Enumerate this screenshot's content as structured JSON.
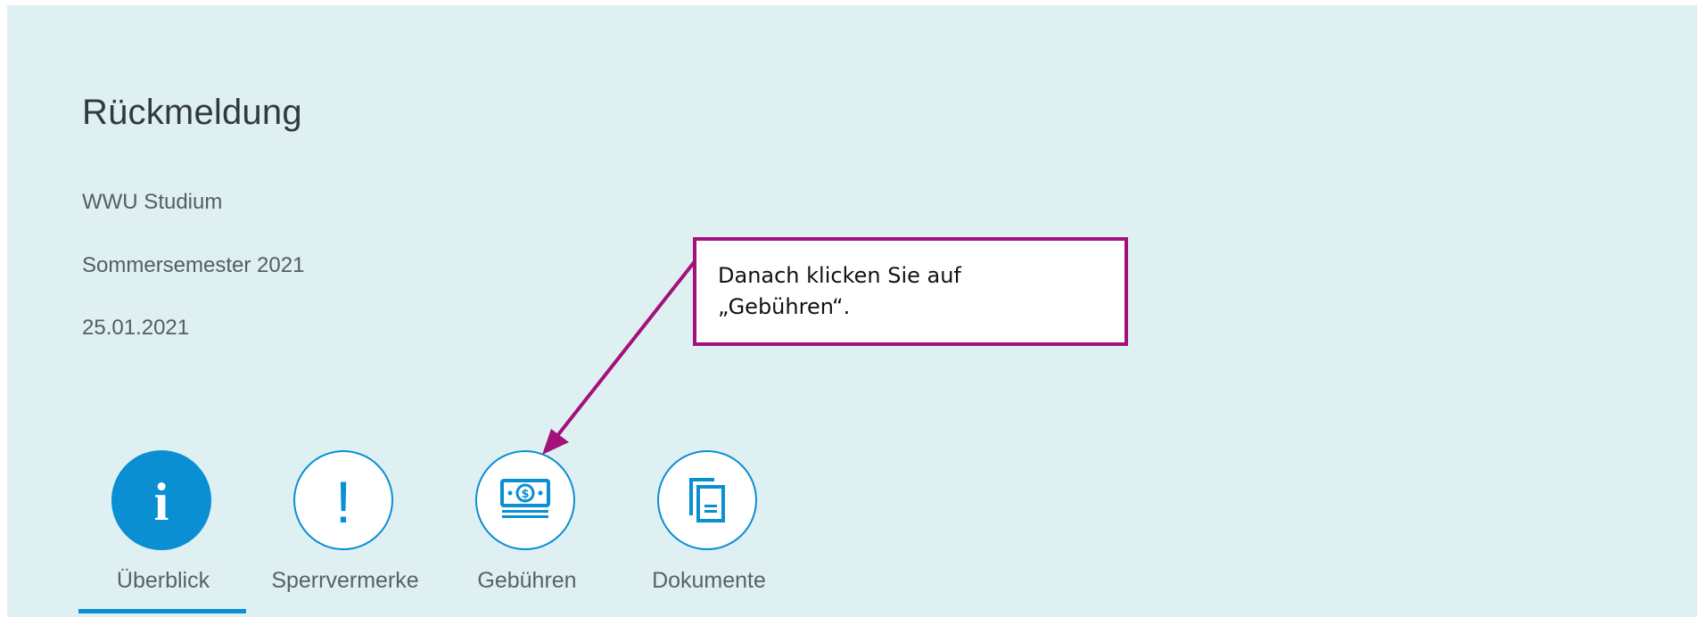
{
  "header": {
    "title": "Rückmeldung",
    "program": "WWU Studium",
    "semester": "Sommersemester 2021",
    "date": "25.01.2021"
  },
  "tabs": [
    {
      "label": "Überblick",
      "icon": "info-icon",
      "active": true
    },
    {
      "label": "Sperrvermerke",
      "icon": "exclamation-icon",
      "active": false
    },
    {
      "label": "Gebühren",
      "icon": "money-icon",
      "active": false
    },
    {
      "label": "Dokumente",
      "icon": "document-icon",
      "active": false
    }
  ],
  "callout": {
    "text_line1": "Danach klicken Sie auf",
    "text_line2": "„Gebühren“."
  },
  "colors": {
    "accent": "#0a8fd3",
    "panel_background": "#dff0f3",
    "callout_border": "#a3117a"
  }
}
